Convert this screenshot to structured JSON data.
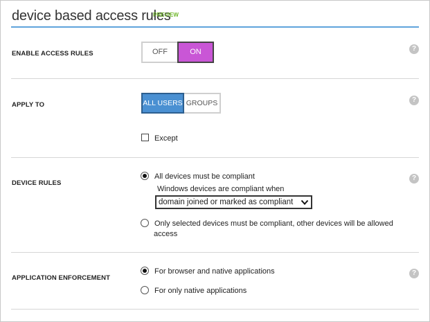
{
  "header": {
    "title": "device based access rules",
    "badge": "PREVIEW"
  },
  "help_glyph": "?",
  "enable_access": {
    "label": "ENABLE ACCESS RULES",
    "off_label": "OFF",
    "on_label": "ON",
    "selected": "ON",
    "active_color": "#c956d6"
  },
  "apply_to": {
    "label": "APPLY TO",
    "options": [
      "ALL USERS",
      "GROUPS"
    ],
    "selected": "ALL USERS",
    "active_color": "#4a90d2",
    "except_label": "Except",
    "except_checked": false
  },
  "device_rules": {
    "label": "DEVICE RULES",
    "option_all": "All devices must be compliant",
    "windows_label": "Windows devices are compliant when",
    "select_value": "domain joined or marked as compliant",
    "option_selected_line1": "Only selected devices must be compliant, other devices will be allowed",
    "option_selected_line2": "access",
    "selected": "All devices must be compliant"
  },
  "app_enforcement": {
    "label": "APPLICATION ENFORCEMENT",
    "option_browser": "For browser and native applications",
    "option_native": "For only native applications",
    "selected": "For browser and native applications"
  },
  "colors": {
    "header_rule": "#5fa3dc",
    "preview": "#6fb62b"
  }
}
